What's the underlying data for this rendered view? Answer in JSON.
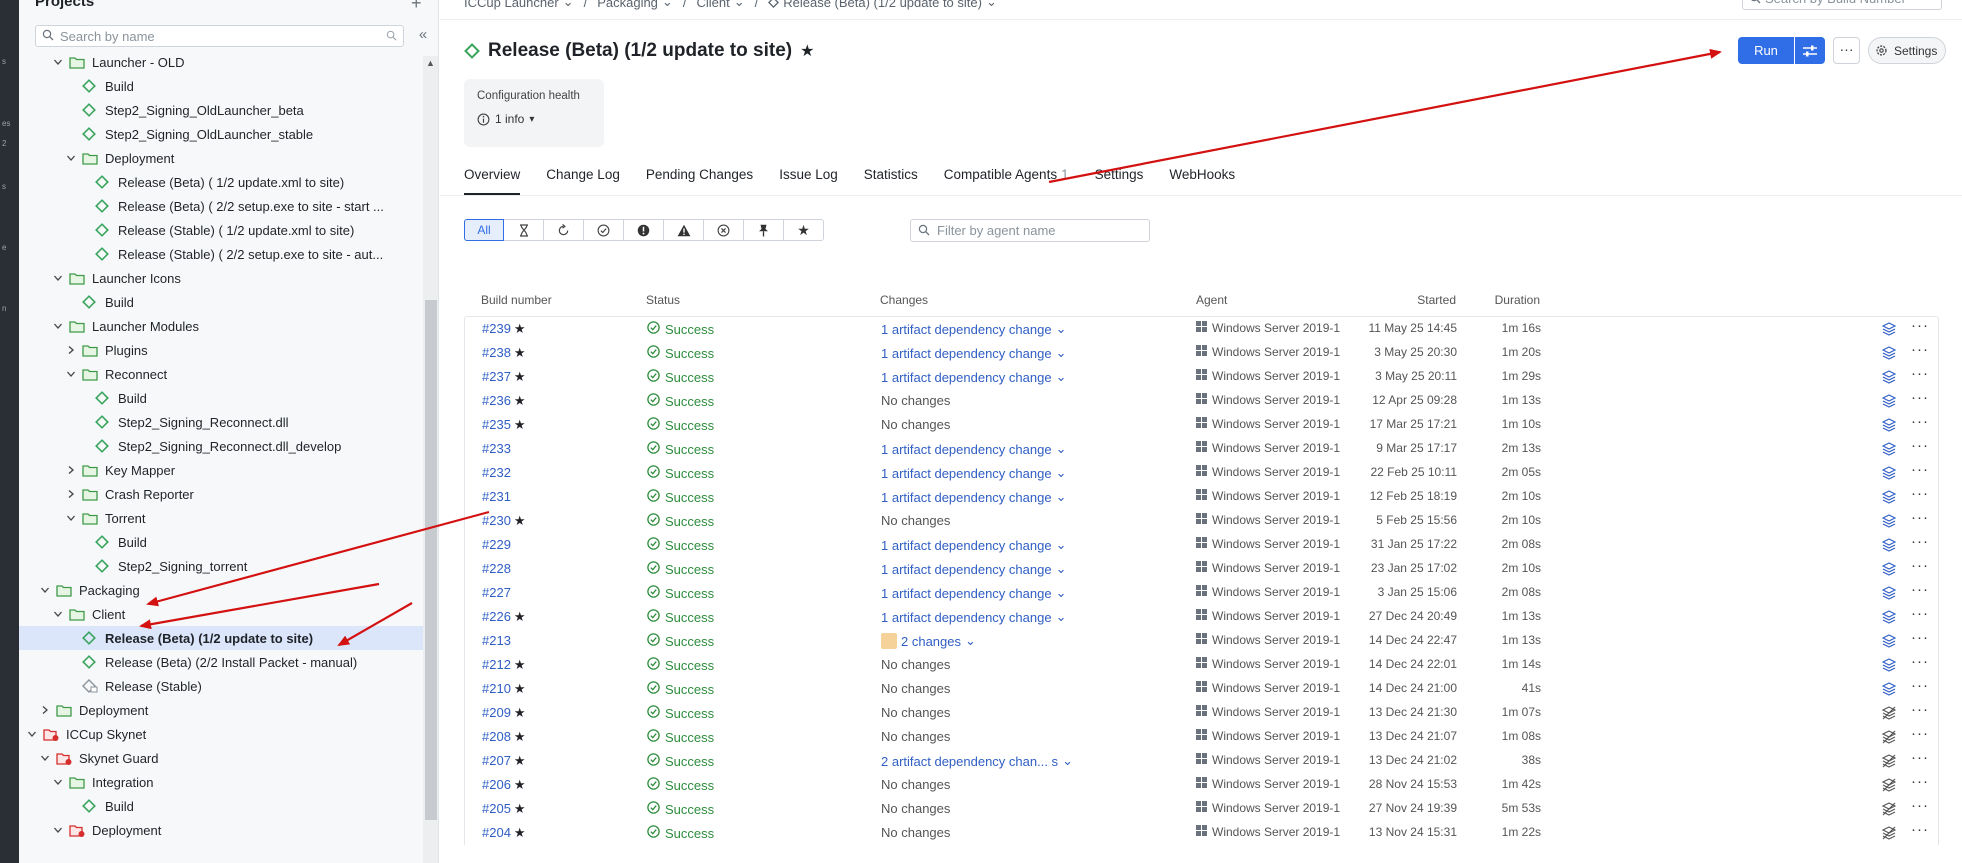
{
  "sidebar": {
    "title": "Projects",
    "search_placeholder": "Search by name",
    "tree": [
      {
        "label": "Launcher - OLD",
        "type": "folder",
        "level": 3,
        "expanded": true
      },
      {
        "label": "Build",
        "type": "config",
        "level": 4
      },
      {
        "label": "Step2_Signing_OldLauncher_beta",
        "type": "config",
        "level": 4
      },
      {
        "label": "Step2_Signing_OldLauncher_stable",
        "type": "config",
        "level": 4
      },
      {
        "label": "Deployment",
        "type": "folder",
        "level": 4,
        "expanded": true
      },
      {
        "label": "Release (Beta) ( 1/2 update.xml to site)",
        "type": "config",
        "level": 5
      },
      {
        "label": "Release (Beta) ( 2/2 setup.exe to site - start ...",
        "type": "config",
        "level": 5
      },
      {
        "label": "Release (Stable) ( 1/2 update.xml to site)",
        "type": "config",
        "level": 5
      },
      {
        "label": "Release (Stable) ( 2/2 setup.exe to site - aut...",
        "type": "config",
        "level": 5
      },
      {
        "label": "Launcher Icons",
        "type": "folder",
        "level": 3,
        "expanded": true
      },
      {
        "label": "Build",
        "type": "config",
        "level": 4
      },
      {
        "label": "Launcher Modules",
        "type": "folder",
        "level": 3,
        "expanded": true
      },
      {
        "label": "Plugins",
        "type": "folder",
        "level": 4,
        "expanded": false
      },
      {
        "label": "Reconnect",
        "type": "folder",
        "level": 4,
        "expanded": true
      },
      {
        "label": "Build",
        "type": "config",
        "level": 5
      },
      {
        "label": "Step2_Signing_Reconnect.dll",
        "type": "config",
        "level": 5
      },
      {
        "label": "Step2_Signing_Reconnect.dll_develop",
        "type": "config",
        "level": 5
      },
      {
        "label": "Key Mapper",
        "type": "folder",
        "level": 4,
        "expanded": false
      },
      {
        "label": "Crash Reporter",
        "type": "folder",
        "level": 4,
        "expanded": false
      },
      {
        "label": "Torrent",
        "type": "folder",
        "level": 4,
        "expanded": true
      },
      {
        "label": "Build",
        "type": "config",
        "level": 5
      },
      {
        "label": "Step2_Signing_torrent",
        "type": "config",
        "level": 5
      },
      {
        "label": "Packaging",
        "type": "folder",
        "level": 2,
        "expanded": true
      },
      {
        "label": "Client",
        "type": "folder",
        "level": 3,
        "expanded": true
      },
      {
        "label": "Release (Beta) (1/2 update to site)",
        "type": "config",
        "level": 4,
        "selected": true
      },
      {
        "label": "Release (Beta) (2/2 Install Packet - manual)",
        "type": "config",
        "level": 4
      },
      {
        "label": "Release (Stable)",
        "type": "config-paused",
        "level": 4
      },
      {
        "label": "Deployment",
        "type": "folder",
        "level": 2,
        "expanded": false
      },
      {
        "label": "ICCup Skynet",
        "type": "project-red",
        "level": 1,
        "expanded": true
      },
      {
        "label": "Skynet Guard",
        "type": "project-red",
        "level": 2,
        "expanded": true
      },
      {
        "label": "Integration",
        "type": "folder",
        "level": 3,
        "expanded": true
      },
      {
        "label": "Build",
        "type": "config",
        "level": 4
      },
      {
        "label": "Deployment",
        "type": "project-red",
        "level": 3,
        "expanded": true
      }
    ]
  },
  "breadcrumb": [
    "ICCup Launcher",
    "Packaging",
    "Client",
    "Release (Beta) (1/2 update to site)"
  ],
  "build_search_placeholder": "Search by Build Number",
  "title": "Release (Beta) (1/2 update to site)",
  "actions": {
    "run": "Run",
    "settings": "Settings",
    "more": "···"
  },
  "health": {
    "label": "Configuration health",
    "info": "1 info"
  },
  "tabs": [
    {
      "label": "Overview",
      "active": true
    },
    {
      "label": "Change Log"
    },
    {
      "label": "Pending Changes"
    },
    {
      "label": "Issue Log"
    },
    {
      "label": "Statistics"
    },
    {
      "label": "Compatible Agents",
      "count": "1"
    },
    {
      "label": "Settings"
    },
    {
      "label": "WebHooks"
    }
  ],
  "filters": {
    "all_label": "All",
    "icons": [
      "hourglass-icon",
      "refresh-icon",
      "check-circle-icon",
      "exclamation-icon",
      "warning-icon",
      "cancel-icon",
      "pin-icon",
      "star-icon"
    ],
    "agent_placeholder": "Filter by agent name"
  },
  "columns": {
    "build": "Build number",
    "status": "Status",
    "changes": "Changes",
    "agent": "Agent",
    "started": "Started",
    "duration": "Duration"
  },
  "builds": [
    {
      "num": "#239",
      "pinned": true,
      "status": "Success",
      "changes": "1 artifact dependency change",
      "dep": true,
      "agent": "Windows Server 2019-1",
      "started": "11 May 25 14:45",
      "duration": "1m 16s",
      "art": "stack"
    },
    {
      "num": "#238",
      "pinned": true,
      "status": "Success",
      "changes": "1 artifact dependency change",
      "dep": true,
      "agent": "Windows Server 2019-1",
      "started": "3 May 25 20:30",
      "duration": "1m 20s",
      "art": "stack"
    },
    {
      "num": "#237",
      "pinned": true,
      "status": "Success",
      "changes": "1 artifact dependency change",
      "dep": true,
      "agent": "Windows Server 2019-1",
      "started": "3 May 25 20:11",
      "duration": "1m 29s",
      "art": "stack"
    },
    {
      "num": "#236",
      "pinned": true,
      "status": "Success",
      "changes": "No changes",
      "dep": false,
      "agent": "Windows Server 2019-1",
      "started": "12 Apr 25 09:28",
      "duration": "1m 13s",
      "art": "stack"
    },
    {
      "num": "#235",
      "pinned": true,
      "status": "Success",
      "changes": "No changes",
      "dep": false,
      "agent": "Windows Server 2019-1",
      "started": "17 Mar 25 17:21",
      "duration": "1m 10s",
      "art": "stack"
    },
    {
      "num": "#233",
      "pinned": false,
      "status": "Success",
      "changes": "1 artifact dependency change",
      "dep": true,
      "agent": "Windows Server 2019-1",
      "started": "9 Mar 25 17:17",
      "duration": "2m 13s",
      "art": "stack"
    },
    {
      "num": "#232",
      "pinned": false,
      "status": "Success",
      "changes": "1 artifact dependency change",
      "dep": true,
      "agent": "Windows Server 2019-1",
      "started": "22 Feb 25 10:11",
      "duration": "2m 05s",
      "art": "stack"
    },
    {
      "num": "#231",
      "pinned": false,
      "status": "Success",
      "changes": "1 artifact dependency change",
      "dep": true,
      "agent": "Windows Server 2019-1",
      "started": "12 Feb 25 18:19",
      "duration": "2m 10s",
      "art": "stack"
    },
    {
      "num": "#230",
      "pinned": true,
      "status": "Success",
      "changes": "No changes",
      "dep": false,
      "agent": "Windows Server 2019-1",
      "started": "5 Feb 25 15:56",
      "duration": "2m 10s",
      "art": "stack"
    },
    {
      "num": "#229",
      "pinned": false,
      "status": "Success",
      "changes": "1 artifact dependency change",
      "dep": true,
      "agent": "Windows Server 2019-1",
      "started": "31 Jan 25 17:22",
      "duration": "2m 08s",
      "art": "stack"
    },
    {
      "num": "#228",
      "pinned": false,
      "status": "Success",
      "changes": "1 artifact dependency change",
      "dep": true,
      "agent": "Windows Server 2019-1",
      "started": "23 Jan 25 17:02",
      "duration": "2m 10s",
      "art": "stack"
    },
    {
      "num": "#227",
      "pinned": false,
      "status": "Success",
      "changes": "1 artifact dependency change",
      "dep": true,
      "agent": "Windows Server 2019-1",
      "started": "3 Jan 25 15:06",
      "duration": "2m 08s",
      "art": "stack"
    },
    {
      "num": "#226",
      "pinned": true,
      "status": "Success",
      "changes": "1 artifact dependency change",
      "dep": true,
      "agent": "Windows Server 2019-1",
      "started": "27 Dec 24 20:49",
      "duration": "1m 13s",
      "art": "stack"
    },
    {
      "num": "#213",
      "pinned": false,
      "status": "Success",
      "changes": "2 changes",
      "dep": true,
      "avatar": true,
      "agent": "Windows Server 2019-1",
      "started": "14 Dec 24 22:47",
      "duration": "1m 13s",
      "art": "stack"
    },
    {
      "num": "#212",
      "pinned": true,
      "status": "Success",
      "changes": "No changes",
      "dep": false,
      "agent": "Windows Server 2019-1",
      "started": "14 Dec 24 22:01",
      "duration": "1m 14s",
      "art": "stack"
    },
    {
      "num": "#210",
      "pinned": true,
      "status": "Success",
      "changes": "No changes",
      "dep": false,
      "agent": "Windows Server 2019-1",
      "started": "14 Dec 24 21:00",
      "duration": "41s",
      "art": "stack"
    },
    {
      "num": "#209",
      "pinned": true,
      "status": "Success",
      "changes": "No changes",
      "dep": false,
      "agent": "Windows Server 2019-1",
      "started": "13 Dec 24 21:30",
      "duration": "1m 07s",
      "art": "none"
    },
    {
      "num": "#208",
      "pinned": true,
      "status": "Success",
      "changes": "No changes",
      "dep": false,
      "agent": "Windows Server 2019-1",
      "started": "13 Dec 24 21:07",
      "duration": "1m 08s",
      "art": "none"
    },
    {
      "num": "#207",
      "pinned": true,
      "status": "Success",
      "changes": "2 artifact dependency chan... s",
      "dep": true,
      "agent": "Windows Server 2019-1",
      "started": "13 Dec 24 21:02",
      "duration": "38s",
      "art": "none"
    },
    {
      "num": "#206",
      "pinned": true,
      "status": "Success",
      "changes": "No changes",
      "dep": false,
      "agent": "Windows Server 2019-1",
      "started": "28 Nov 24 15:53",
      "duration": "1m 42s",
      "art": "none"
    },
    {
      "num": "#205",
      "pinned": true,
      "status": "Success",
      "changes": "No changes",
      "dep": false,
      "agent": "Windows Server 2019-1",
      "started": "27 Nov 24 19:39",
      "duration": "5m 53s",
      "art": "none"
    },
    {
      "num": "#204",
      "pinned": true,
      "status": "Success",
      "changes": "No changes",
      "dep": false,
      "agent": "Windows Server 2019-1",
      "started": "13 Nov 24 15:31",
      "duration": "1m 22s",
      "art": "none"
    }
  ],
  "colors": {
    "accent": "#2f6ee6",
    "link": "#2f5ec4",
    "success": "#2f8d3e",
    "folder": "#6bbf67",
    "config": "#3aa55d",
    "annotation": "#d41111",
    "selected": "#dbe6fb"
  }
}
